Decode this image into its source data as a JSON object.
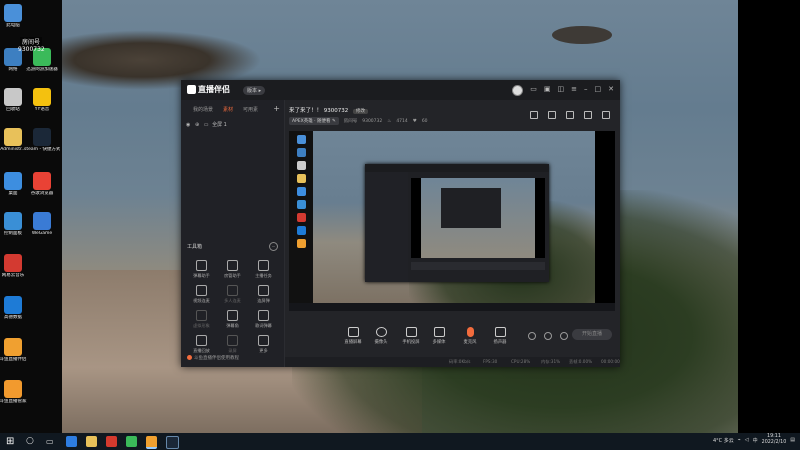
{
  "colors": {
    "accent": "#f36c3d",
    "window_bg": "#1f2024",
    "taskbar_bg": "#101820"
  },
  "desktop_icons": [
    {
      "label": "此电脑",
      "color": "#4a90d9",
      "icon": "computer-icon"
    },
    {
      "label": "网络",
      "color": "#3d7fc1",
      "icon": "network-icon"
    },
    {
      "label": "回收站",
      "color": "#c8c8c8",
      "icon": "recycle-bin-icon"
    },
    {
      "label": "Administr...",
      "color": "#e8c15a",
      "icon": "folder-icon"
    },
    {
      "label": "桌面",
      "color": "#3d8ee0",
      "icon": "desktop-icon"
    },
    {
      "label": "控制面板",
      "color": "#3a8fd6",
      "icon": "control-panel-icon"
    },
    {
      "label": "网易云音乐",
      "color": "#d33a31",
      "icon": "netease-music-icon"
    },
    {
      "label": "高德数据",
      "color": "#1e7bd6",
      "icon": "gaode-icon"
    },
    {
      "label": "斗鱼直播伴侣",
      "color": "#f0a030",
      "icon": "douyu-icon"
    },
    {
      "label": "斗鱼直播管家",
      "color": "#f29a2e",
      "icon": "douyu-manager-icon"
    },
    {
      "label": "迅游网游加速器",
      "color": "#3bba5a",
      "icon": "xunyou-icon"
    },
    {
      "label": "YY语音",
      "color": "#f4c10f",
      "icon": "yy-icon"
    },
    {
      "label": "steam - 快捷方式",
      "color": "#1b2838",
      "icon": "steam-icon"
    },
    {
      "label": "谷歌浏览器",
      "color": "#e94235",
      "icon": "chrome-icon"
    },
    {
      "label": "WeGame",
      "color": "#3a7bd5",
      "icon": "wegame-icon"
    }
  ],
  "overlay_user": {
    "label": "房间号",
    "value": "9300732"
  },
  "app": {
    "logo": "直播伴侣",
    "version_badge": "版本",
    "sidebar_tabs": [
      {
        "label": "我的场景",
        "active": false
      },
      {
        "label": "素材",
        "active": true
      },
      {
        "label": "可用素",
        "active": false
      }
    ],
    "scene_name": "全屏 1",
    "tools_title": "工具箱",
    "tools": [
      {
        "label": "弹幕助手",
        "enabled": true
      },
      {
        "label": "房管助手",
        "enabled": true
      },
      {
        "label": "主播任务",
        "enabled": true
      },
      {
        "label": "视频连麦",
        "enabled": true
      },
      {
        "label": "多人连麦",
        "enabled": false
      },
      {
        "label": "连屏弹",
        "enabled": true
      },
      {
        "label": "虚拟形象",
        "enabled": false
      },
      {
        "label": "弹幕角",
        "enabled": true
      },
      {
        "label": "歌词弹幕",
        "enabled": true
      },
      {
        "label": "直播回放",
        "enabled": true
      },
      {
        "label": "录屏",
        "enabled": false
      },
      {
        "label": "更多",
        "enabled": true
      }
    ],
    "sidebar_status": "斗鱼直播伴侣使用教程",
    "room_title": "来了来了！！ 9300732",
    "room_title_tag": "修改",
    "room_category": "APEX英雄 · 随便看",
    "room_number_label": "房间号",
    "room_number": "9300732",
    "hot_value": "4714",
    "fans_value": "60",
    "controls": [
      {
        "label": "直播屏幕"
      },
      {
        "label": "摄像头"
      },
      {
        "label": "手机投屏"
      },
      {
        "label": "多媒体"
      },
      {
        "label": "麦克风"
      },
      {
        "label": "扬声器"
      }
    ],
    "start_live": "开始直播",
    "statusbar": {
      "bitrate": "码率:0Kb/s",
      "fps": "FPS:30",
      "cpu": "CPU:28%",
      "mem": "内存:31%",
      "dropped": "丢帧:0.00%",
      "time": "00:00:00"
    }
  },
  "taskbar": {
    "weather": "4°C 多云",
    "time": "19:11",
    "date": "2022/2/10",
    "input_method": "中"
  }
}
